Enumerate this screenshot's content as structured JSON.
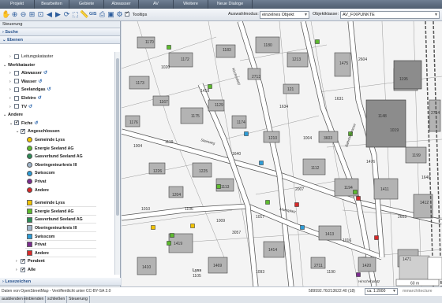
{
  "menu": [
    "Projekt",
    "Bearbeiten",
    "Gebiete",
    "Abwasser",
    "AV",
    "Weitere",
    "Neue Dialoge"
  ],
  "toolbar": {
    "gis_label": "GIS",
    "tooltips_label": "Tooltips",
    "mode_label": "Auswahlmodus:",
    "mode_value": "einzelnes Objekt",
    "class_label": "Objektklasse:",
    "class_value": "AV_FIXPUNKTE"
  },
  "panel": {
    "title": "Steuerung",
    "suche": "Suche",
    "ebenen": "Ebenen",
    "lesezeichen": "Lesezeichen",
    "tree": [
      {
        "label": "Leitungskataster",
        "level": 1,
        "twisty": "›",
        "checkbox": true,
        "checked": false,
        "bold": false
      },
      {
        "label": "Werkkataster",
        "level": 0,
        "twisty": "⌄",
        "checkbox": false,
        "bold": true
      },
      {
        "label": "Abwasser",
        "level": 1,
        "twisty": "›",
        "checkbox": true,
        "checked": false,
        "bold": true,
        "info": true
      },
      {
        "label": "Wasser",
        "level": 1,
        "twisty": "›",
        "checkbox": true,
        "checked": false,
        "bold": true,
        "info": true
      },
      {
        "label": "Seelandgas",
        "level": 1,
        "twisty": "›",
        "checkbox": true,
        "checked": false,
        "bold": true,
        "info": true
      },
      {
        "label": "Elektro",
        "level": 1,
        "twisty": "›",
        "checkbox": true,
        "checked": false,
        "bold": true,
        "info": true
      },
      {
        "label": "TV",
        "level": 1,
        "twisty": "›",
        "checkbox": true,
        "checked": false,
        "bold": true,
        "info": true
      },
      {
        "label": "Andere",
        "level": 0,
        "twisty": "⌄",
        "checkbox": false,
        "bold": true
      },
      {
        "label": "Fiche",
        "level": 1,
        "twisty": "⌄",
        "checkbox": true,
        "checked": true,
        "bold": true,
        "info": true
      },
      {
        "label": "Angeschlossen",
        "level": 2,
        "twisty": "⌄",
        "checkbox": true,
        "checked": true,
        "bold": true
      }
    ],
    "legend_circles": [
      {
        "label": "Gemeinde Lyss",
        "color": "#f2c300"
      },
      {
        "label": "Energie Seeland AG",
        "color": "#5dbb2f"
      },
      {
        "label": "Gasverbund Seeland AG",
        "color": "#2e8b57"
      },
      {
        "label": "Oberingenieurkreis III",
        "color": "#9fb3c8"
      },
      {
        "label": "Swisscom",
        "color": "#2d9cd6"
      },
      {
        "label": "Privat",
        "color": "#7b2d8e"
      },
      {
        "label": "Andere",
        "color": "#d62a2a"
      }
    ],
    "legend_squares": [
      {
        "label": "Gemeinde Lyss",
        "color": "#f2c300"
      },
      {
        "label": "Energie Seeland AG",
        "color": "#5dbb2f"
      },
      {
        "label": "Gasverbund Seeland AG",
        "color": "#2e8b57"
      },
      {
        "label": "Oberingenieurkreis III",
        "color": "#9fb3c8"
      },
      {
        "label": "Swisscom",
        "color": "#2d9cd6"
      },
      {
        "label": "Privat",
        "color": "#7b2d8e"
      },
      {
        "label": "Andere",
        "color": "#d62a2a"
      }
    ],
    "tree_tail": [
      {
        "label": "Pendent",
        "level": 2,
        "twisty": "›",
        "checkbox": true,
        "checked": true,
        "bold": true
      },
      {
        "label": "Alle",
        "level": 2,
        "twisty": "›",
        "checkbox": true,
        "checked": true,
        "bold": true
      }
    ]
  },
  "map": {
    "parcels": [
      "1170",
      "1172",
      "1173",
      "1167",
      "1175",
      "1176",
      "1183",
      "1180",
      "1129",
      "1174",
      "1213",
      "121",
      "1210",
      "1225",
      "1226",
      "1204",
      "1113",
      "1112",
      "3603",
      "1194",
      "1148",
      "1195",
      "1199",
      "1411",
      "1412",
      "1413",
      "1414",
      "1419",
      "1469",
      "1410",
      "1420",
      "1471",
      "1475",
      "2714",
      "2711",
      "2713",
      "1418",
      "1119",
      "1010",
      "1640",
      "1634",
      "1631",
      "1476",
      "2603",
      "1190",
      "1093",
      "1105",
      "1004",
      "1004",
      "1009",
      "1016",
      "1019",
      "1017",
      "1106",
      "2007",
      "1020",
      "2604",
      "1640",
      "3057"
    ],
    "streets": [
      "Bahnhofstrasse",
      "Hirschenplatz",
      "Steinweg",
      "Marktplatz",
      "Kirchenfeld"
    ],
    "place_label": "Lyss",
    "scale": "60 m"
  },
  "footer": {
    "attribution": "Daten von OpenStreetMap - Veröffentlicht unter CC-BY-SA 2.0",
    "coords": "589592.76/213622.40 (18)",
    "scale_select": "ca. 1:2000",
    "brand": "mmarchitecture"
  },
  "status": {
    "buttons": [
      "ausblenden",
      "einblenden",
      "schließen",
      "Steuerung"
    ]
  }
}
